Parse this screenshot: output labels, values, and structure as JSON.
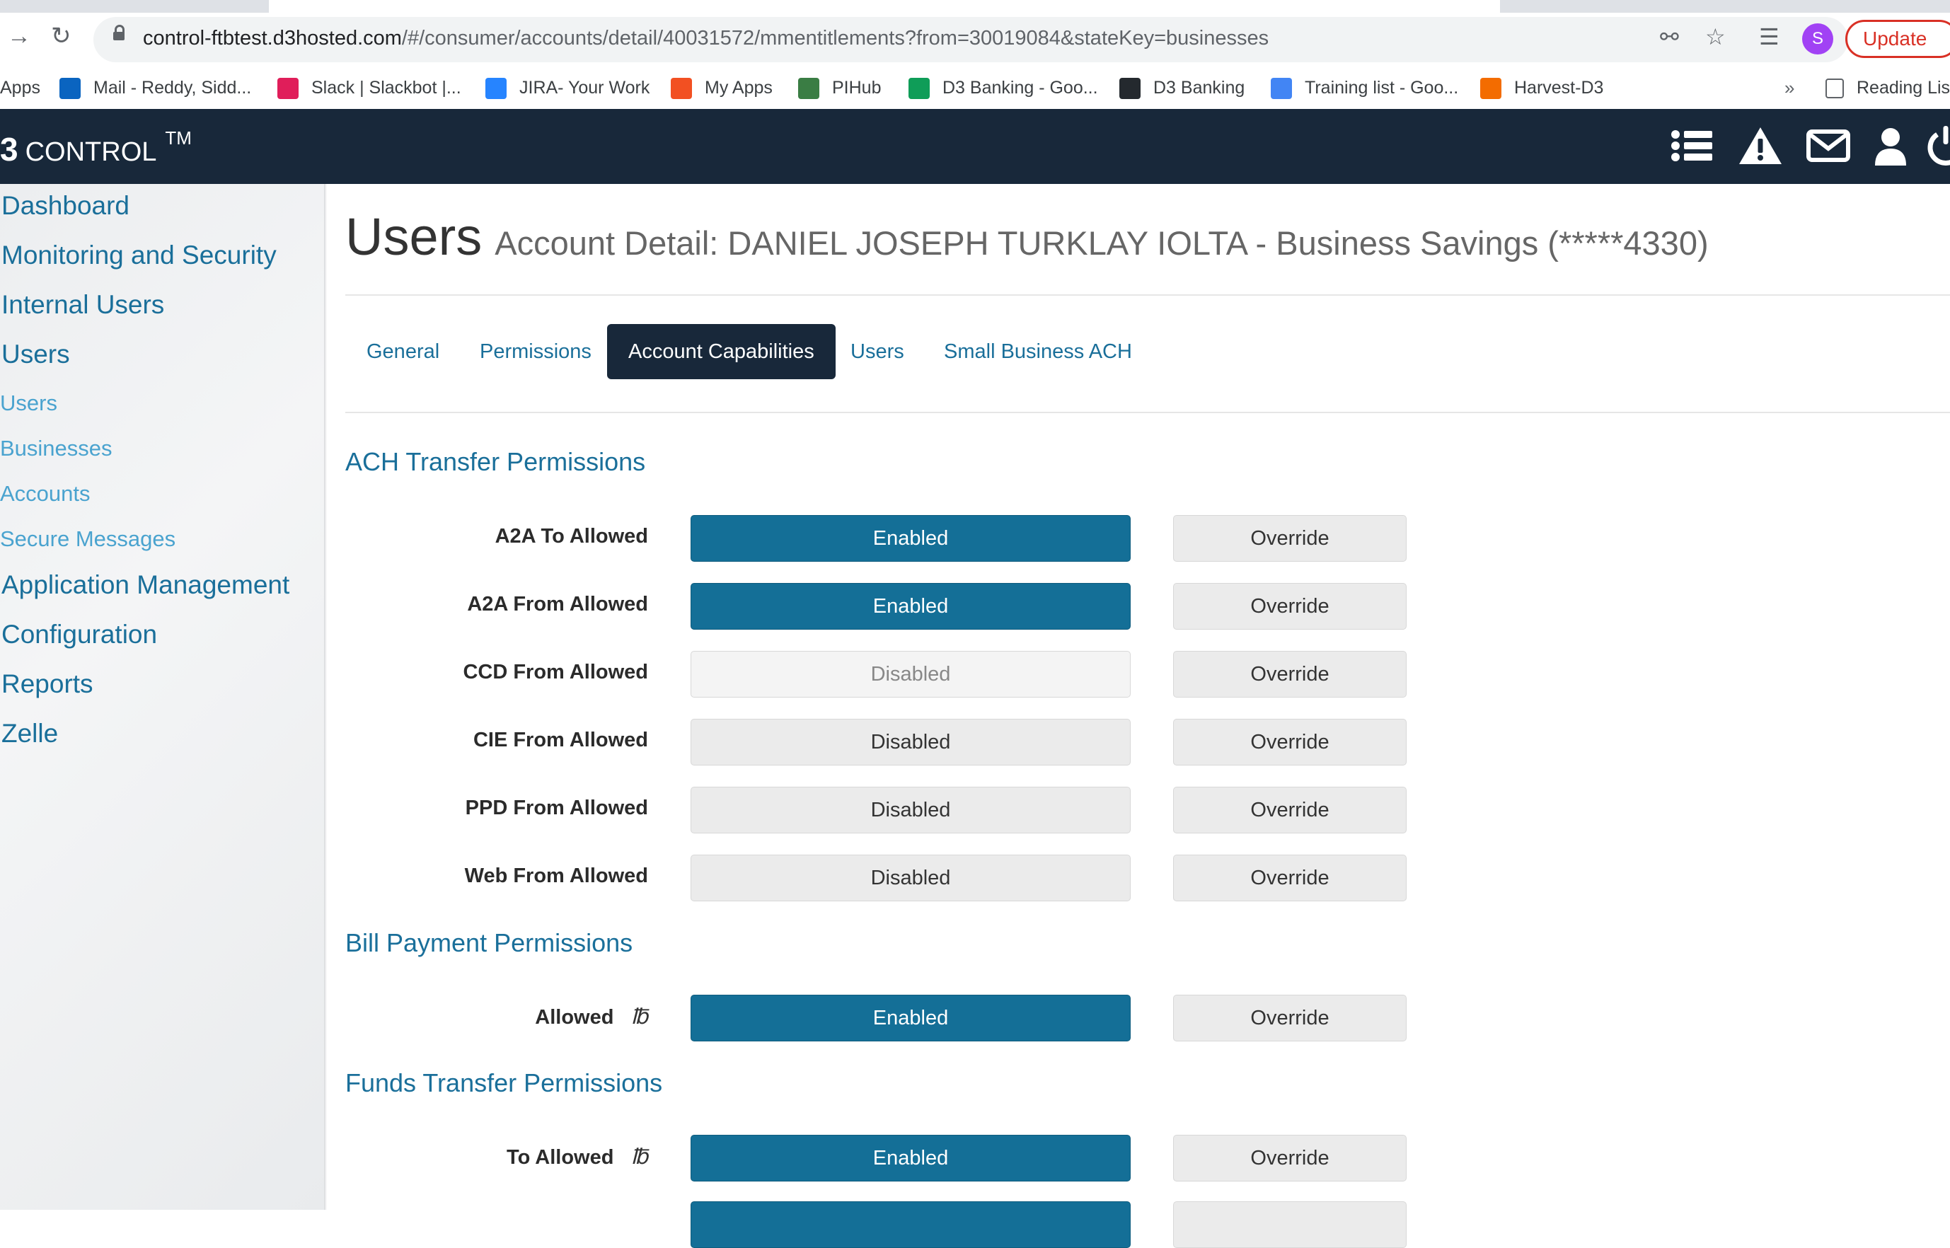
{
  "browser": {
    "url_host": "control-ftbtest.d3hosted.com",
    "url_path": "/#/consumer/accounts/detail/40031572/mmentitlements?from=30019084&stateKey=businesses",
    "profile_initial": "S",
    "update_label": "Update",
    "bookmarks": [
      {
        "label": "Apps",
        "icon_color": ""
      },
      {
        "label": "Mail - Reddy, Sidd...",
        "icon_color": "#0a64c0"
      },
      {
        "label": "Slack | Slackbot |...",
        "icon_color": "#e01e5a"
      },
      {
        "label": "JIRA- Your Work",
        "icon_color": "#2684ff"
      },
      {
        "label": "My Apps",
        "icon_color": "#f25022"
      },
      {
        "label": "PIHub",
        "icon_color": "#3a7d44"
      },
      {
        "label": "D3 Banking - Goo...",
        "icon_color": "#0f9d58"
      },
      {
        "label": "D3 Banking",
        "icon_color": "#24292e"
      },
      {
        "label": "Training list - Goo...",
        "icon_color": "#4285f4"
      },
      {
        "label": "Harvest-D3",
        "icon_color": "#f36c00"
      }
    ],
    "overflow_label": "»",
    "reading_list_label": "Reading Lis"
  },
  "header": {
    "brand_logo": "3",
    "brand_name": "CONTROL",
    "brand_tm": "TM",
    "icons": [
      "list-icon",
      "warning-icon",
      "mail-icon",
      "user-icon",
      "power-icon"
    ]
  },
  "sidebar": {
    "items": [
      {
        "label": "Dashboard"
      },
      {
        "label": "Monitoring and Security"
      },
      {
        "label": "Internal Users"
      },
      {
        "label": "Users"
      },
      {
        "label": "Users",
        "sub": true
      },
      {
        "label": "Businesses",
        "sub": true
      },
      {
        "label": "Accounts",
        "sub": true
      },
      {
        "label": "Secure Messages",
        "sub": true
      },
      {
        "label": "Application Management"
      },
      {
        "label": "Configuration"
      },
      {
        "label": "Reports"
      },
      {
        "label": "Zelle"
      }
    ]
  },
  "main": {
    "title": "Users",
    "subtitle": "Account Detail: DANIEL JOSEPH TURKLAY IOLTA - Business Savings (*****4330)",
    "tabs": [
      {
        "label": "General"
      },
      {
        "label": "Permissions"
      },
      {
        "label": "Account Capabilities",
        "active": true
      },
      {
        "label": "Users"
      },
      {
        "label": "Small Business ACH"
      }
    ],
    "override_label": "Override",
    "sections": [
      {
        "title": "ACH Transfer Permissions",
        "rows": [
          {
            "label": "A2A To Allowed",
            "state": "Enabled"
          },
          {
            "label": "A2A From Allowed",
            "state": "Enabled"
          },
          {
            "label": "CCD From Allowed",
            "state": "Disabled"
          },
          {
            "label": "CIE From Allowed",
            "state": "Disabled"
          },
          {
            "label": "PPD From Allowed",
            "state": "Disabled"
          },
          {
            "label": "Web From Allowed",
            "state": "Disabled"
          }
        ]
      },
      {
        "title": "Bill Payment Permissions",
        "rows": [
          {
            "label": "Allowed",
            "state": "Enabled",
            "info": true
          }
        ]
      },
      {
        "title": "Funds Transfer Permissions",
        "rows": [
          {
            "label": "To Allowed",
            "state": "Enabled",
            "info": true
          }
        ]
      }
    ]
  }
}
